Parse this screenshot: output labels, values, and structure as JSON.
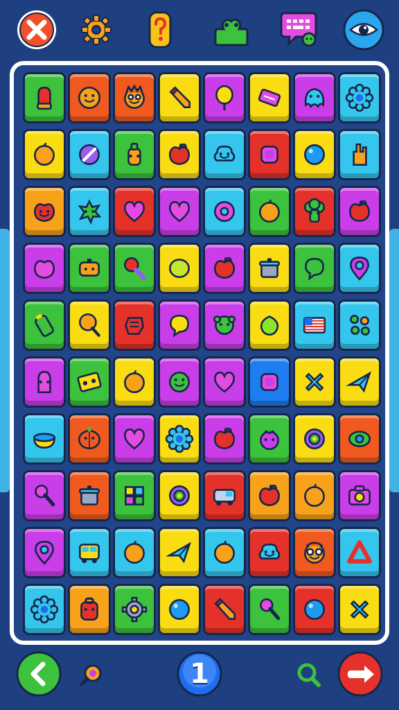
{
  "toolbar": {
    "buttons": [
      {
        "id": "close",
        "icon": "close-icon",
        "bg": "#f0502a"
      },
      {
        "id": "settings",
        "icon": "gear-icon",
        "bg": "#f7a21a"
      },
      {
        "id": "help",
        "icon": "question-icon",
        "bg": "#f7c21a"
      },
      {
        "id": "puzzle",
        "icon": "puzzle-piece-icon",
        "bg": "#3cc23c"
      },
      {
        "id": "chat",
        "icon": "chat-keyboard-icon",
        "bg": "#e44be0"
      },
      {
        "id": "eye",
        "icon": "eye-icon",
        "bg": "#2aa6ef"
      }
    ]
  },
  "board": {
    "rows": [
      [
        {
          "bg": "#3cc23c",
          "icon": "mitten-icon"
        },
        {
          "bg": "#f05a1e",
          "icon": "smiley-face-icon"
        },
        {
          "bg": "#f05a1e",
          "icon": "monster-face-icon"
        },
        {
          "bg": "#f9dd12",
          "icon": "pencil-icon"
        },
        {
          "bg": "#c93ee8",
          "icon": "balloon-icon"
        },
        {
          "bg": "#f9dd12",
          "icon": "ticket-icon"
        },
        {
          "bg": "#c93ee8",
          "icon": "alien-icon"
        },
        {
          "bg": "#35c6ee",
          "icon": "gear-flower-icon"
        }
      ],
      [
        {
          "bg": "#f9dd12",
          "icon": "orange-fruit-icon"
        },
        {
          "bg": "#35c6ee",
          "icon": "no-sign-icon"
        },
        {
          "bg": "#3cc23c",
          "icon": "robot-bottle-icon"
        },
        {
          "bg": "#f9dd12",
          "icon": "apple-icon"
        },
        {
          "bg": "#35c6ee",
          "icon": "cloud-face-icon"
        },
        {
          "bg": "#e4322a",
          "icon": "purple-square-icon"
        },
        {
          "bg": "#f9dd12",
          "icon": "blue-ball-icon"
        },
        {
          "bg": "#35c6ee",
          "icon": "hand-icon"
        }
      ],
      [
        {
          "bg": "#f7a21a",
          "icon": "apple-face-icon"
        },
        {
          "bg": "#35c6ee",
          "icon": "green-splat-icon"
        },
        {
          "bg": "#e4322a",
          "icon": "heart-icon"
        },
        {
          "bg": "#c93ee8",
          "icon": "heart-icon"
        },
        {
          "bg": "#35c6ee",
          "icon": "donut-icon"
        },
        {
          "bg": "#3cc23c",
          "icon": "orange-fruit-icon"
        },
        {
          "bg": "#e4322a",
          "icon": "broccoli-face-icon"
        },
        {
          "bg": "#c93ee8",
          "icon": "apple-icon"
        }
      ],
      [
        {
          "bg": "#c93ee8",
          "icon": "purple-apple-icon"
        },
        {
          "bg": "#3cc23c",
          "icon": "robot-box-icon"
        },
        {
          "bg": "#3cc23c",
          "icon": "magnifier-icon"
        },
        {
          "bg": "#f9dd12",
          "icon": "lemon-icon"
        },
        {
          "bg": "#c93ee8",
          "icon": "apple-icon"
        },
        {
          "bg": "#f9dd12",
          "icon": "cooking-pot-icon"
        },
        {
          "bg": "#3cc23c",
          "icon": "speech-bubble-icon"
        },
        {
          "bg": "#35c6ee",
          "icon": "map-pin-icon"
        }
      ],
      [
        {
          "bg": "#3cc23c",
          "icon": "battery-icon"
        },
        {
          "bg": "#f9dd12",
          "icon": "lollipop-icon"
        },
        {
          "bg": "#e4322a",
          "icon": "red-fist-icon"
        },
        {
          "bg": "#c93ee8",
          "icon": "lemon-bubble-icon"
        },
        {
          "bg": "#c93ee8",
          "icon": "green-monster-icon"
        },
        {
          "bg": "#f9dd12",
          "icon": "lime-icon"
        },
        {
          "bg": "#35c6ee",
          "icon": "flag-icon"
        },
        {
          "bg": "#35c6ee",
          "icon": "leaves-icon"
        }
      ],
      [
        {
          "bg": "#c93ee8",
          "icon": "ghost-bottle-icon"
        },
        {
          "bg": "#3cc23c",
          "icon": "cassette-icon"
        },
        {
          "bg": "#f9dd12",
          "icon": "orange-fruit-icon"
        },
        {
          "bg": "#c93ee8",
          "icon": "green-smiley-icon"
        },
        {
          "bg": "#c93ee8",
          "icon": "heart-icon"
        },
        {
          "bg": "#1e7df0",
          "icon": "purple-square-icon"
        },
        {
          "bg": "#f9dd12",
          "icon": "x-cross-icon"
        },
        {
          "bg": "#f9dd12",
          "icon": "paper-plane-icon"
        }
      ],
      [
        {
          "bg": "#35c6ee",
          "icon": "bowl-icon"
        },
        {
          "bg": "#f05a1e",
          "icon": "pumpkin-icon"
        },
        {
          "bg": "#c93ee8",
          "icon": "heart-icon"
        },
        {
          "bg": "#f9dd12",
          "icon": "gear-flower-icon"
        },
        {
          "bg": "#c93ee8",
          "icon": "apple-icon"
        },
        {
          "bg": "#3cc23c",
          "icon": "purple-berry-icon"
        },
        {
          "bg": "#f9dd12",
          "icon": "ring-icon"
        },
        {
          "bg": "#f05a1e",
          "icon": "eye-disc-icon"
        }
      ],
      [
        {
          "bg": "#c93ee8",
          "icon": "microphone-icon"
        },
        {
          "bg": "#f05a1e",
          "icon": "cooking-pot-icon"
        },
        {
          "bg": "#3cc23c",
          "icon": "blocks-icon"
        },
        {
          "bg": "#f9dd12",
          "icon": "ring-icon"
        },
        {
          "bg": "#e4322a",
          "icon": "van-icon"
        },
        {
          "bg": "#f7a21a",
          "icon": "apple-icon"
        },
        {
          "bg": "#f7a21a",
          "icon": "orange-fruit-icon"
        },
        {
          "bg": "#c93ee8",
          "icon": "camera-icon"
        }
      ],
      [
        {
          "bg": "#c93ee8",
          "icon": "map-pin-icon"
        },
        {
          "bg": "#35c6ee",
          "icon": "bus-icon"
        },
        {
          "bg": "#35c6ee",
          "icon": "orange-fruit-icon"
        },
        {
          "bg": "#f9dd12",
          "icon": "paper-plane-icon"
        },
        {
          "bg": "#35c6ee",
          "icon": "orange-fruit-icon"
        },
        {
          "bg": "#e4322a",
          "icon": "cloud-face-icon"
        },
        {
          "bg": "#f05a1e",
          "icon": "glasses-face-icon"
        },
        {
          "bg": "#35c6ee",
          "icon": "triangle-icon"
        }
      ],
      [
        {
          "bg": "#35c6ee",
          "icon": "gear-flower-icon"
        },
        {
          "bg": "#f7a21a",
          "icon": "backpack-icon"
        },
        {
          "bg": "#3cc23c",
          "icon": "gear-icon"
        },
        {
          "bg": "#f9dd12",
          "icon": "blue-ball-icon"
        },
        {
          "bg": "#e4322a",
          "icon": "pencil-icon"
        },
        {
          "bg": "#3cc23c",
          "icon": "microphone-icon"
        },
        {
          "bg": "#e4322a",
          "icon": "blue-ball-icon"
        },
        {
          "bg": "#f9dd12",
          "icon": "x-cross-icon"
        }
      ]
    ]
  },
  "bottom": {
    "back": {
      "icon": "arrow-left-icon",
      "bg": "#3cc23c"
    },
    "hint": {
      "icon": "hint-magnifier-icon",
      "bg": "#f7a21a"
    },
    "level": {
      "label": "1",
      "bg": "#1e6cf0"
    },
    "zoom": {
      "icon": "search-icon",
      "bg": "#3cc23c"
    },
    "exit": {
      "icon": "arrow-right-icon",
      "bg": "#e4322a"
    }
  }
}
